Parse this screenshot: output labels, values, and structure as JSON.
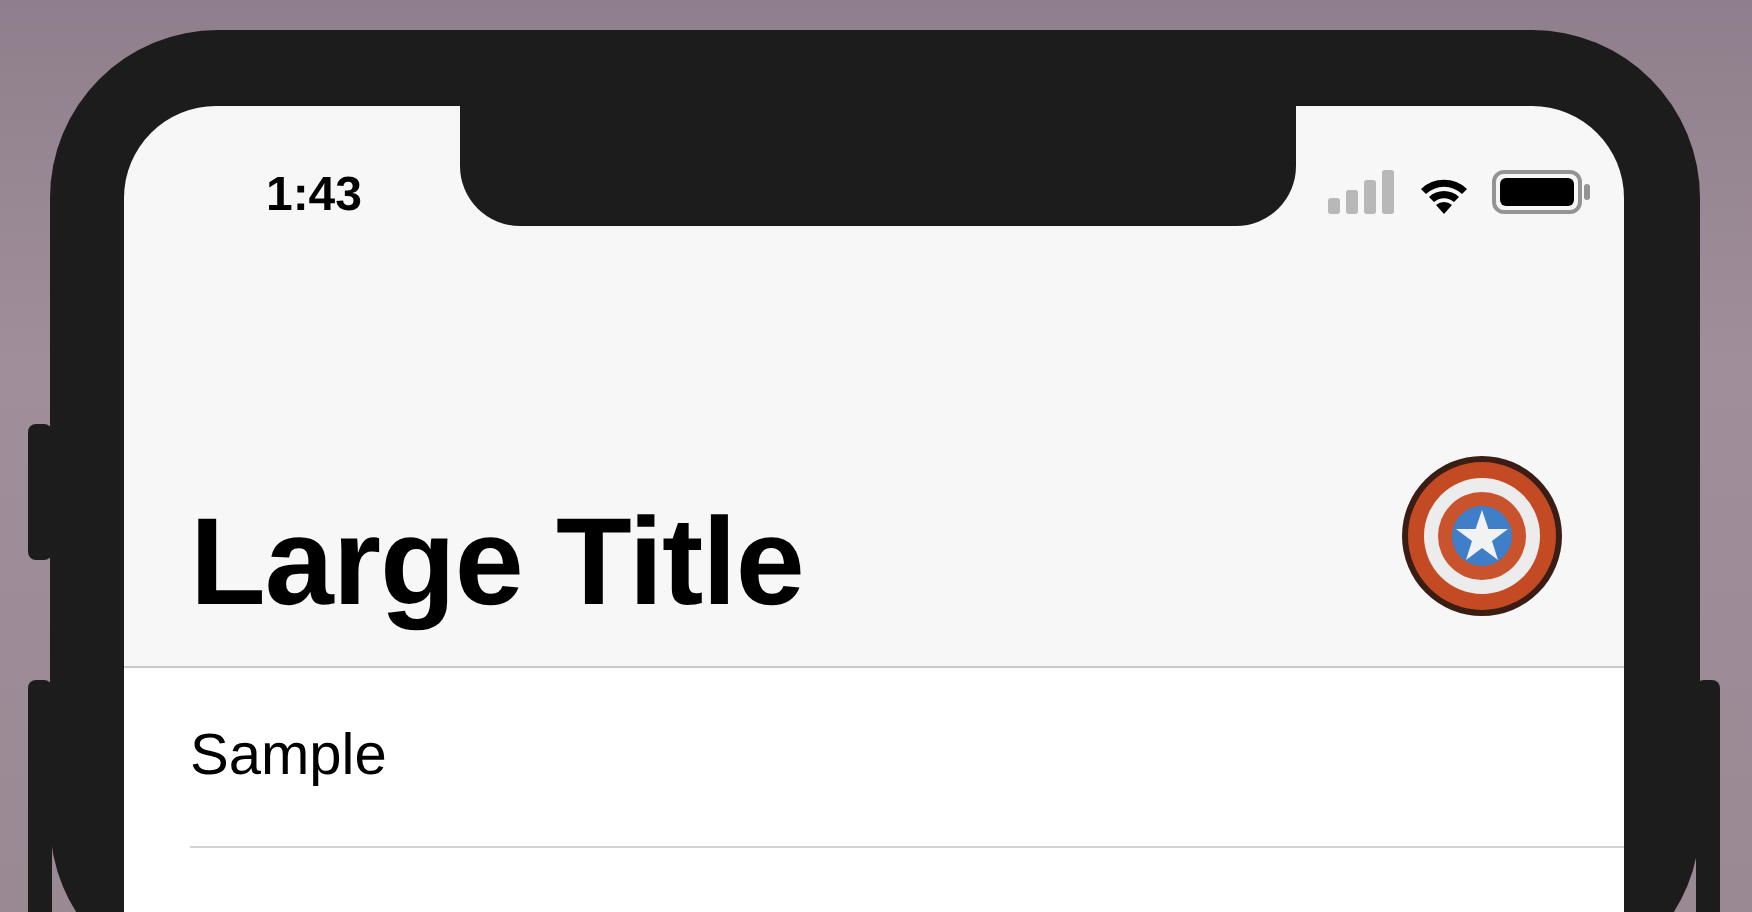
{
  "status_bar": {
    "time": "1:43"
  },
  "navigation": {
    "title": "Large Title"
  },
  "list": {
    "rows": [
      {
        "label": "Sample"
      }
    ]
  }
}
